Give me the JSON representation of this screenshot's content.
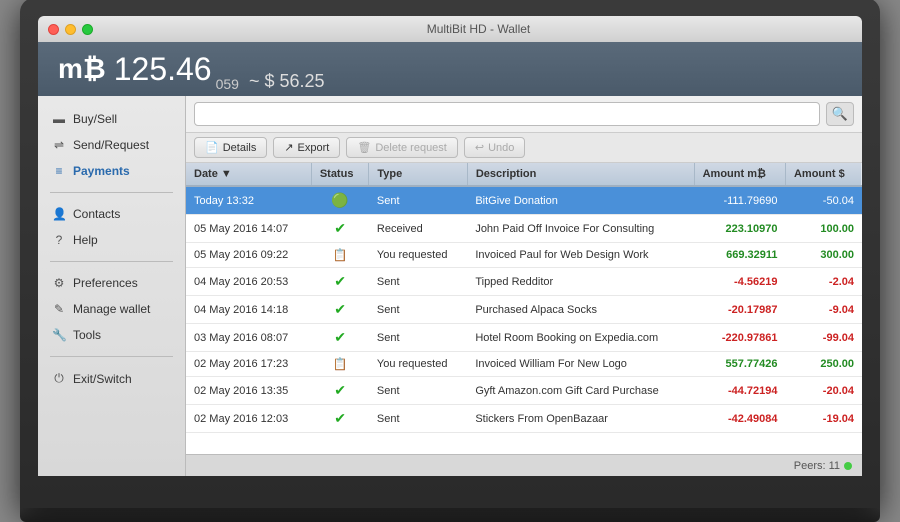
{
  "titlebar": {
    "title": "MultiBit HD - Wallet"
  },
  "header": {
    "logo": "m₿",
    "balance_main": "125.46",
    "balance_decimal": "059",
    "separator": "~",
    "balance_usd": "$ 56.25"
  },
  "sidebar": {
    "items": [
      {
        "id": "buy-sell",
        "label": "Buy/Sell",
        "icon": "▬",
        "active": false
      },
      {
        "id": "send-request",
        "label": "Send/Request",
        "icon": "⇌",
        "active": false
      },
      {
        "id": "payments",
        "label": "Payments",
        "icon": "≡",
        "active": true
      }
    ],
    "items2": [
      {
        "id": "contacts",
        "label": "Contacts",
        "icon": "👤",
        "active": false
      },
      {
        "id": "help",
        "label": "Help",
        "icon": "?",
        "active": false
      }
    ],
    "items3": [
      {
        "id": "preferences",
        "label": "Preferences",
        "icon": "⚙",
        "active": false
      },
      {
        "id": "manage-wallet",
        "label": "Manage wallet",
        "icon": "✎",
        "active": false
      },
      {
        "id": "tools",
        "label": "Tools",
        "icon": "🔧",
        "active": false
      }
    ],
    "items4": [
      {
        "id": "exit-switch",
        "label": "Exit/Switch",
        "icon": "⏻",
        "active": false
      }
    ]
  },
  "toolbar": {
    "search_placeholder": "",
    "search_icon": "🔍",
    "details_label": "Details",
    "export_label": "Export",
    "delete_label": "Delete request",
    "undo_label": "Undo"
  },
  "table": {
    "headers": [
      "Date",
      "Status",
      "Type",
      "Description",
      "Amount m₿",
      "Amount $"
    ],
    "rows": [
      {
        "date": "Today 13:32",
        "status": "sent_green",
        "type": "Sent",
        "description": "BitGive Donation",
        "amount_btc": "-111.79690",
        "amount_usd": "-50.04",
        "selected": true
      },
      {
        "date": "05 May 2016 14:07",
        "status": "received",
        "type": "Received",
        "description": "John Paid Off Invoice For Consulting",
        "amount_btc": "223.10970",
        "amount_usd": "100.00",
        "selected": false
      },
      {
        "date": "05 May 2016 09:22",
        "status": "requested",
        "type": "You requested",
        "description": "Invoiced Paul for Web Design Work",
        "amount_btc": "669.32911",
        "amount_usd": "300.00",
        "selected": false
      },
      {
        "date": "04 May 2016 20:53",
        "status": "sent_check",
        "type": "Sent",
        "description": "Tipped Redditor",
        "amount_btc": "-4.56219",
        "amount_usd": "-2.04",
        "selected": false
      },
      {
        "date": "04 May 2016 14:18",
        "status": "sent_check",
        "type": "Sent",
        "description": "Purchased Alpaca Socks",
        "amount_btc": "-20.17987",
        "amount_usd": "-9.04",
        "selected": false
      },
      {
        "date": "03 May 2016 08:07",
        "status": "sent_check",
        "type": "Sent",
        "description": "Hotel Room Booking on Expedia.com",
        "amount_btc": "-220.97861",
        "amount_usd": "-99.04",
        "selected": false
      },
      {
        "date": "02 May 2016 17:23",
        "status": "requested",
        "type": "You requested",
        "description": "Invoiced William For New Logo",
        "amount_btc": "557.77426",
        "amount_usd": "250.00",
        "selected": false
      },
      {
        "date": "02 May 2016 13:35",
        "status": "sent_check",
        "type": "Sent",
        "description": "Gyft Amazon.com Gift Card Purchase",
        "amount_btc": "-44.72194",
        "amount_usd": "-20.04",
        "selected": false
      },
      {
        "date": "02 May 2016 12:03",
        "status": "sent_check",
        "type": "Sent",
        "description": "Stickers From OpenBazaar",
        "amount_btc": "-42.49084",
        "amount_usd": "-19.04",
        "selected": false
      }
    ]
  },
  "footer": {
    "peers_label": "Peers:",
    "peers_count": "11"
  }
}
